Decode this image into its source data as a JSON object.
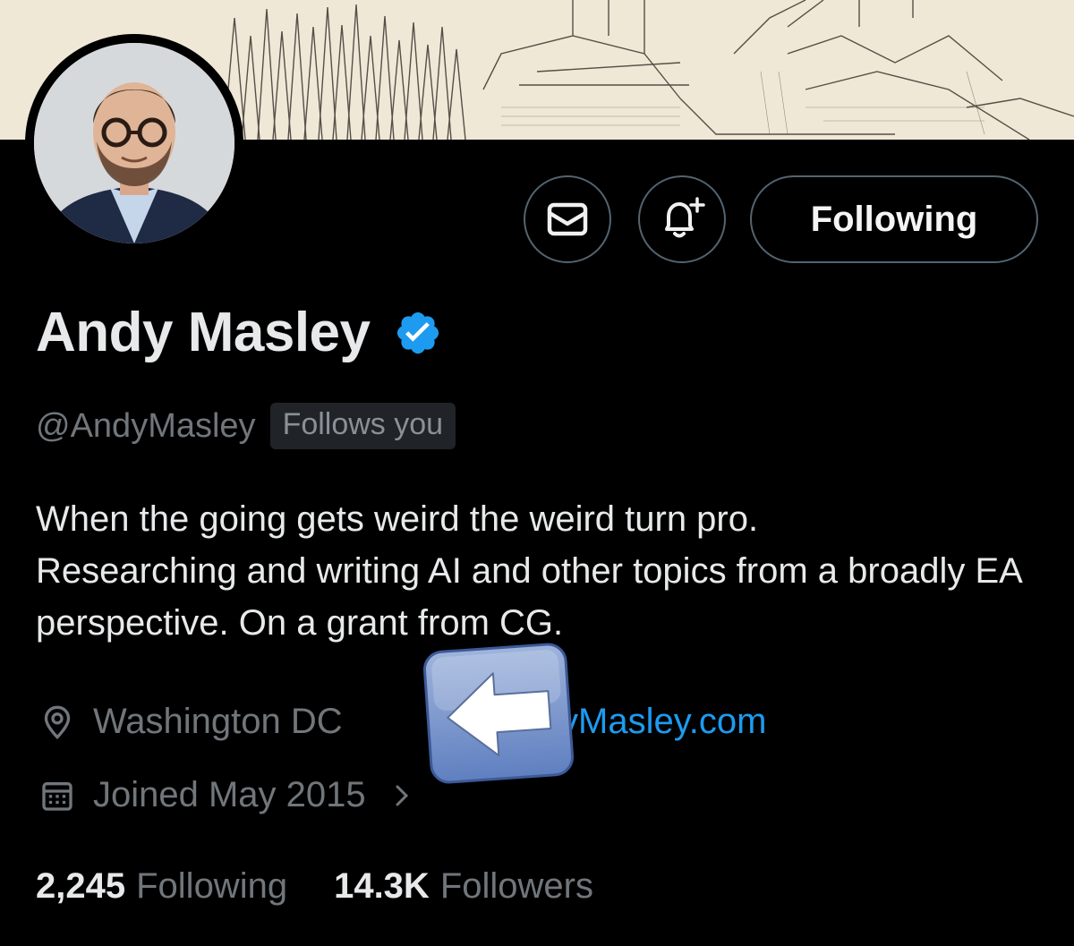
{
  "profile": {
    "display_name": "Andy Masley",
    "handle": "@AndyMasley",
    "follows_you": "Follows you",
    "bio": "When the going gets weird the weird turn pro.\nResearching and writing AI and other topics from a broadly EA perspective. On a grant from CG.",
    "location": "Washington DC",
    "website_visible": "yMasley.com",
    "joined": "Joined May 2015"
  },
  "actions": {
    "following_label": "Following"
  },
  "stats": {
    "following_count": "2,245",
    "following_label": "Following",
    "followers_count": "14.3K",
    "followers_label": "Followers"
  },
  "icons": {
    "message": "envelope-icon",
    "notify": "bell-plus-icon",
    "verified": "verified-badge-icon",
    "location": "map-pin-icon",
    "calendar": "calendar-icon",
    "chevron": "chevron-right-icon",
    "overlay": "left-arrow-emoji"
  },
  "colors": {
    "background": "#000000",
    "text_primary": "#e7e9ea",
    "text_secondary": "#71767b",
    "link": "#1d9bf0",
    "verified": "#1d9bf0",
    "border": "#536471",
    "banner": "#efe8d6"
  }
}
